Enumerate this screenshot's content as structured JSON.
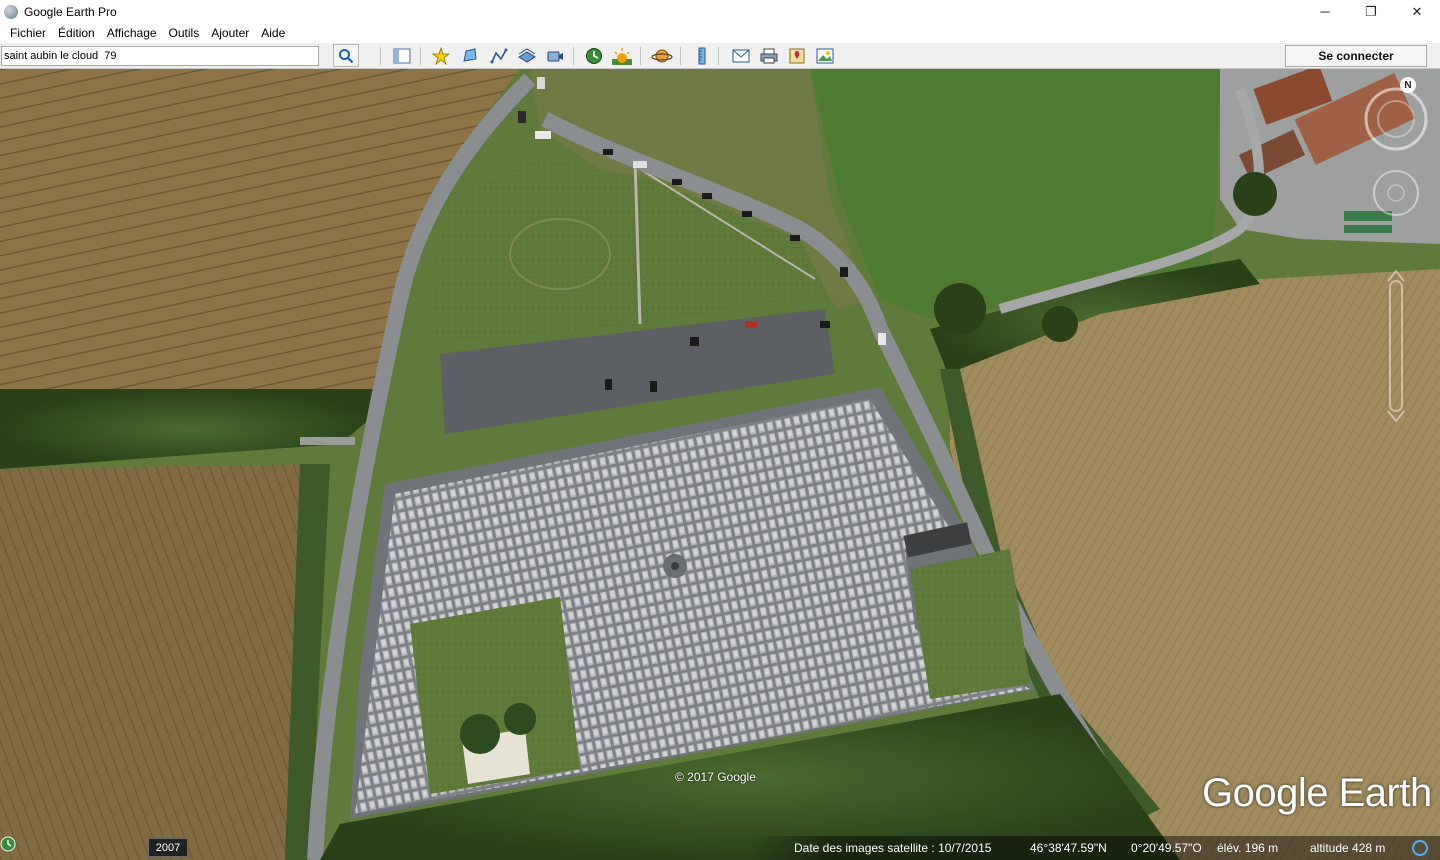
{
  "window": {
    "title": "Google Earth Pro",
    "controls": {
      "minimize": "─",
      "maximize": "❐",
      "close": "✕"
    }
  },
  "menu": {
    "items": [
      "Fichier",
      "Édition",
      "Affichage",
      "Outils",
      "Ajouter",
      "Aide"
    ]
  },
  "toolbar": {
    "search_value": "saint aubin le cloud  79",
    "connect_label": "Se connecter",
    "buttons": [
      "sidebar-icon",
      "placemark-icon",
      "polygon-icon",
      "path-icon",
      "image-overlay-icon",
      "record-tour-icon",
      "historical-imagery-icon",
      "sunlight-icon",
      "planets-icon",
      "ruler-icon",
      "email-icon",
      "print-icon",
      "view-in-maps-icon",
      "save-image-icon"
    ]
  },
  "map": {
    "copyright": "© 2017 Google",
    "brand": "Google Earth",
    "compass_label": "N"
  },
  "status": {
    "year": "2007",
    "imagery_date": "Date des images satellite : 10/7/2015",
    "latitude": "46°38'47.59\"N",
    "longitude": "0°20'49.57\"O",
    "elevation": "élév.  196 m",
    "altitude": "altitude    428 m"
  },
  "colors": {
    "field_wheat": "#8a7444",
    "field_light": "#9b8a5e",
    "grass": "#5f7a3a",
    "trees": "#3d5a2a",
    "road": "#7a7f82",
    "cemetery": "#8e9195"
  }
}
